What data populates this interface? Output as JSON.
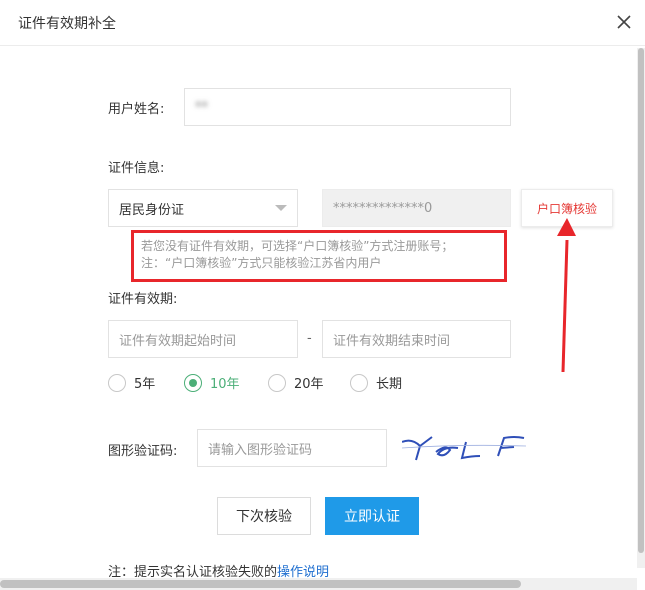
{
  "dialog": {
    "title": "证件有效期补全"
  },
  "form": {
    "name_label": "用户姓名:",
    "name_value": "**",
    "id_info_label": "证件信息:",
    "id_type": "居民身份证",
    "id_number": "**************0",
    "hukou_button": "户口簿核验",
    "notice_line1": "若您没有证件有效期，可选择“户口簿核验”方式注册账号；",
    "notice_line2": "注：“户口簿核验”方式只能核验江苏省内用户",
    "validity_label": "证件有效期:",
    "start_placeholder": "证件有效期起始时间",
    "dash": "-",
    "end_placeholder": "证件有效期结束时间",
    "durations": [
      {
        "label": "5年",
        "checked": false
      },
      {
        "label": "10年",
        "checked": true
      },
      {
        "label": "20年",
        "checked": false
      },
      {
        "label": "长期",
        "checked": false
      }
    ],
    "captcha_label": "图形验证码:",
    "captcha_placeholder": "请输入图形验证码",
    "captcha_text": "YeLF"
  },
  "buttons": {
    "later": "下次核验",
    "verify": "立即认证"
  },
  "note": {
    "prefix": "注：提示实名认证核验失败的",
    "link": "操作说明"
  },
  "colors": {
    "accent": "#1f9ae8",
    "checked": "#4caf78",
    "alert": "#e8262b"
  }
}
